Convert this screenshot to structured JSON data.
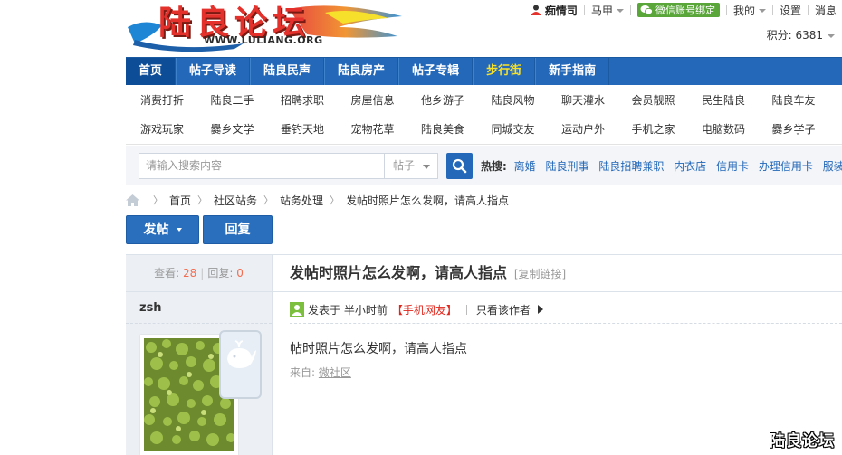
{
  "logo": {
    "text": "陆良论坛",
    "url_text": "WWW.LULIANG.ORG"
  },
  "userbar": {
    "username": "痴情司",
    "vest_label": "马甲",
    "wechat_label": "微信账号绑定",
    "mine_label": "我的",
    "settings_label": "设置",
    "messages_label": "消息",
    "credits": "积分: 6381"
  },
  "nav": {
    "items": [
      {
        "label": "首页"
      },
      {
        "label": "帖子导读"
      },
      {
        "label": "陆良民声"
      },
      {
        "label": "陆良房产"
      },
      {
        "label": "帖子专辑"
      },
      {
        "label": "步行街"
      },
      {
        "label": "新手指南"
      }
    ]
  },
  "subnav": {
    "row1": [
      "消费打折",
      "陆良二手",
      "招聘求职",
      "房屋信息",
      "他乡游子",
      "陆良风物",
      "聊天灌水",
      "会员靓照",
      "民生陆良",
      "陆良车友"
    ],
    "row2": [
      "游戏玩家",
      "爨乡文学",
      "垂钓天地",
      "宠物花草",
      "陆良美食",
      "同城交友",
      "运动户外",
      "手机之家",
      "电脑数码",
      "爨乡学子"
    ]
  },
  "search": {
    "placeholder": "请输入搜索内容",
    "type": "帖子",
    "hot_label": "热搜:",
    "hot_links": [
      "离婚",
      "陆良刑事",
      "陆良招聘兼职",
      "内衣店",
      "信用卡",
      "办理信用卡",
      "服装店"
    ]
  },
  "breadcrumb": [
    "首页",
    "社区站务",
    "站务处理",
    "发帖时照片怎么发啊，请高人指点"
  ],
  "actions": {
    "post_label": "发帖",
    "reply_label": "回复"
  },
  "thread": {
    "views_label": "查看:",
    "views": "28",
    "replies_label": "回复:",
    "replies": "0",
    "author": "zsh",
    "title": "发帖时照片怎么发啊，请高人指点",
    "copy_link": "[复制链接]",
    "posted_prefix": "发表于",
    "posted_time": "半小时前",
    "source_tag": "【手机网友】",
    "only_author": "只看该作者",
    "content": "帖时照片怎么发啊，请高人指点",
    "from_label": "来自:",
    "from_link": "微社区"
  },
  "watermark": "陆良论坛"
}
